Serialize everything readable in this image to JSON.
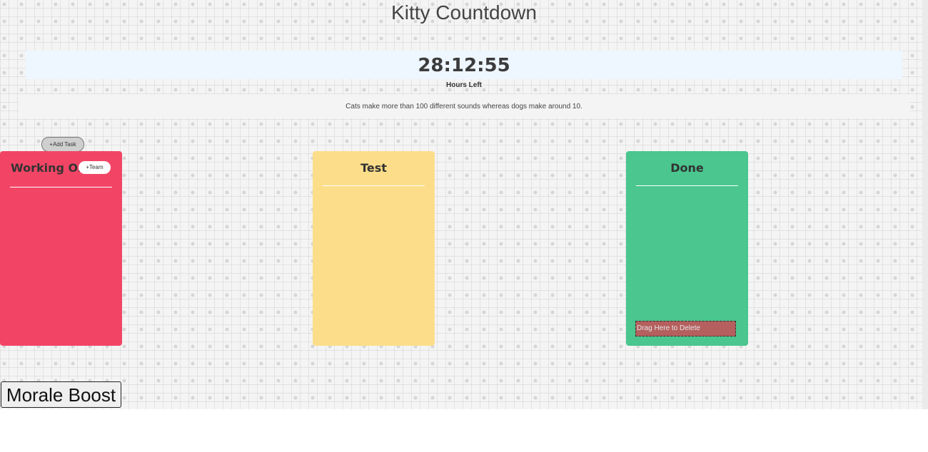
{
  "app": {
    "title": "Kitty Countdown"
  },
  "timer": {
    "value": "28:12:55",
    "label": "Hours Left"
  },
  "fact": {
    "text": "Cats make more than 100 different sounds whereas dogs make around 10."
  },
  "toolbar": {
    "add_task_label": "+Add Task",
    "morale_boost_label": "Morale Boost"
  },
  "columns": {
    "working": {
      "title": "Working On",
      "team_label": "+Team",
      "color": "#f24566"
    },
    "test": {
      "title": "Test",
      "color": "#fcde8a"
    },
    "done": {
      "title": "Done",
      "delete_zone_label": "Drag Here to Delete",
      "color": "#4ac68e"
    }
  }
}
